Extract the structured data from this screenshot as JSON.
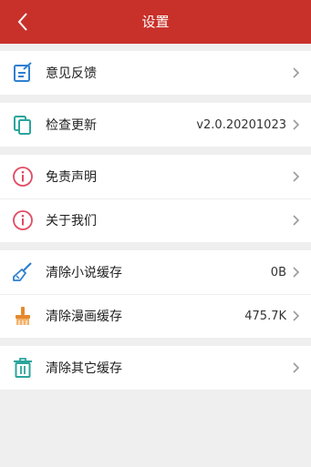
{
  "header": {
    "title": "设置",
    "back_icon": "chevron-left-icon",
    "background": "#c8312a"
  },
  "groups": [
    {
      "items": [
        {
          "label": "意见反馈",
          "icon": "feedback-icon",
          "value": ""
        }
      ]
    },
    {
      "items": [
        {
          "label": "检查更新",
          "icon": "copy-update-icon",
          "value": "v2.0.20201023"
        }
      ]
    },
    {
      "items": [
        {
          "label": "免责声明",
          "icon": "info-icon",
          "value": ""
        },
        {
          "label": "关于我们",
          "icon": "info-icon",
          "value": ""
        }
      ]
    },
    {
      "items": [
        {
          "label": "清除小说缓存",
          "icon": "brush-icon",
          "value": "0B"
        },
        {
          "label": "清除漫画缓存",
          "icon": "paintbrush-icon",
          "value": "475.7K"
        }
      ]
    },
    {
      "items": [
        {
          "label": "清除其它缓存",
          "icon": "trash-icon",
          "value": ""
        }
      ]
    }
  ],
  "colors": {
    "accent_red": "#c8312a",
    "icon_blue": "#2f7fd1",
    "icon_teal": "#2aa59c",
    "icon_pink": "#e14a62",
    "icon_orange": "#e5892c",
    "chevron_gray": "#9a9a9a"
  }
}
